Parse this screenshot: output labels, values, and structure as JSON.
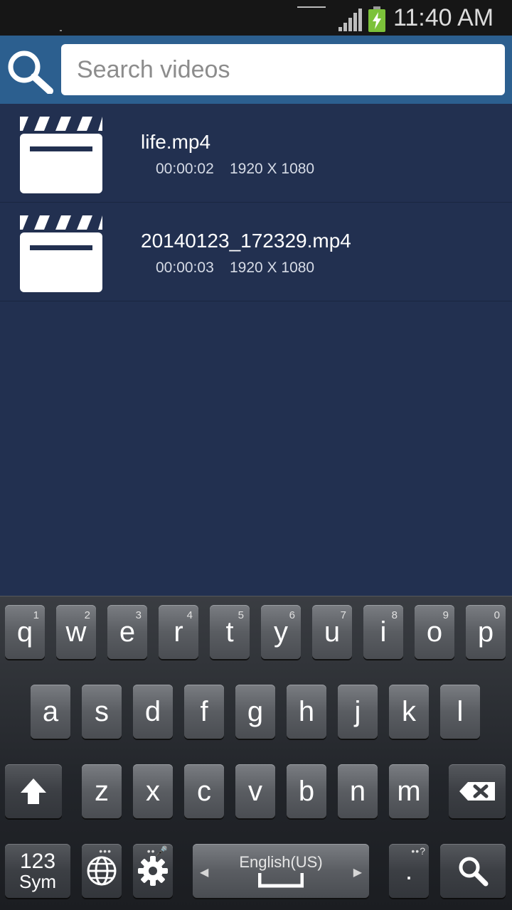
{
  "status_bar": {
    "time": "11:40 AM",
    "colors": {
      "background": "#161616",
      "battery_fill": "#7cc23a"
    }
  },
  "search": {
    "placeholder": "Search videos",
    "value": ""
  },
  "videos": [
    {
      "name": "life.mp4",
      "duration": "00:00:02",
      "resolution": "1920 X 1080"
    },
    {
      "name": "20140123_172329.mp4",
      "duration": "00:00:03",
      "resolution": "1920 X 1080"
    }
  ],
  "keyboard": {
    "row1": [
      {
        "key": "q",
        "num": "1"
      },
      {
        "key": "w",
        "num": "2"
      },
      {
        "key": "e",
        "num": "3"
      },
      {
        "key": "r",
        "num": "4"
      },
      {
        "key": "t",
        "num": "5"
      },
      {
        "key": "y",
        "num": "6"
      },
      {
        "key": "u",
        "num": "7"
      },
      {
        "key": "i",
        "num": "8"
      },
      {
        "key": "o",
        "num": "9"
      },
      {
        "key": "p",
        "num": "0"
      }
    ],
    "row2": [
      "a",
      "s",
      "d",
      "f",
      "g",
      "h",
      "j",
      "k",
      "l"
    ],
    "row3": [
      "z",
      "x",
      "c",
      "v",
      "b",
      "n",
      "m"
    ],
    "sym_top": "123",
    "sym_bottom": "Sym",
    "language": "English(US)",
    "period": ".",
    "period_hint": "?"
  },
  "icons": [
    "search-icon",
    "clapperboard-icon",
    "signal-icon",
    "battery-charging-icon",
    "shift-icon",
    "backspace-icon",
    "globe-icon",
    "settings-icon",
    "keyboard-search-icon"
  ],
  "colors": {
    "header": "#2c5f8f",
    "list_background": "#223050",
    "keyboard_background": "#2a2d32"
  }
}
